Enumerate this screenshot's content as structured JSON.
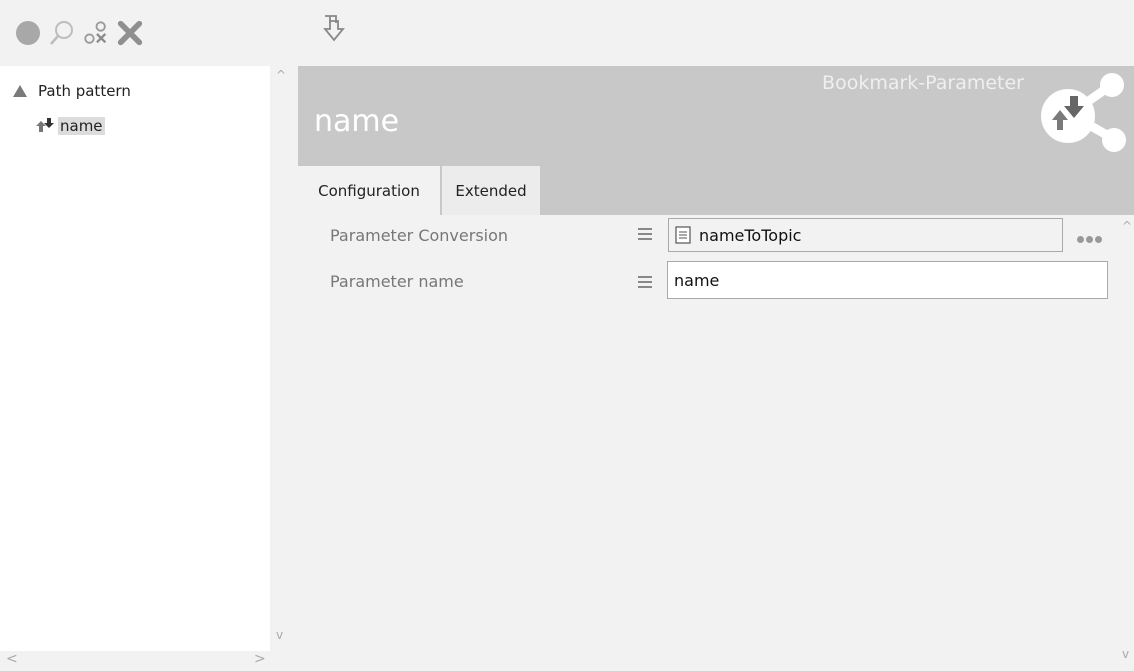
{
  "toolbar": {
    "icons": [
      "record-circle-icon",
      "search-icon",
      "group-remove-icon",
      "delete-x-icon"
    ],
    "right_icon": "import-down-arrow-icon"
  },
  "tree": {
    "root": {
      "label": "Path pattern",
      "icon": "triangle-icon"
    },
    "child": {
      "label": "name",
      "icon": "parameter-arrows-icon",
      "selected": true
    }
  },
  "header": {
    "title": "name",
    "type": "Bookmark-Parameter",
    "logo_icon": "bookmark-parameter-share-icon"
  },
  "tabs": [
    {
      "label": "Configuration",
      "active": true
    },
    {
      "label": "Extended",
      "active": false
    }
  ],
  "properties": {
    "conversion": {
      "label": "Parameter Conversion",
      "value": "nameToTopic",
      "value_icon": "document-icon",
      "more_icon": "ellipsis-icon"
    },
    "name": {
      "label": "Parameter name",
      "value": "name"
    }
  },
  "colors": {
    "header_bg": "#c8c8c8",
    "panel_bg": "#f2f2f2",
    "tree_bg": "#ffffff",
    "selection": "#dcdcdc"
  }
}
